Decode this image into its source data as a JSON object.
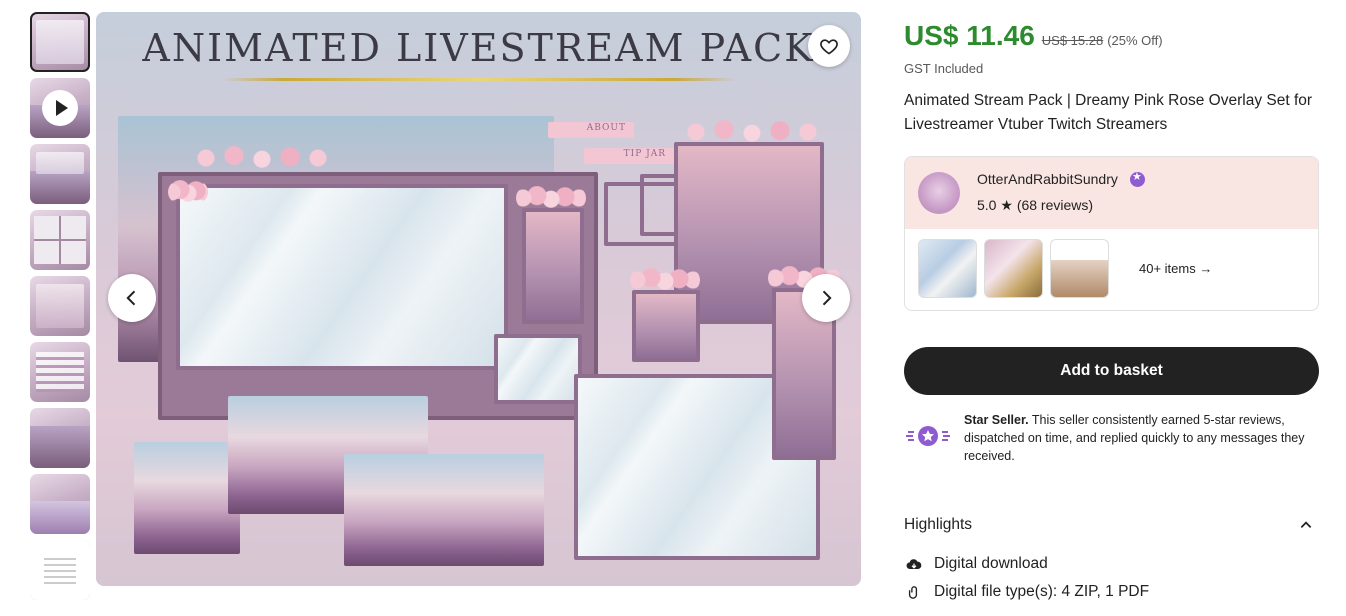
{
  "gallery": {
    "title_text": "ANIMATED LIVESTREAM PACK",
    "labels": {
      "about": "ABOUT",
      "tip_jar": "TIP JAR"
    },
    "thumbnails": [
      {
        "name": "thumb-overview"
      },
      {
        "name": "thumb-video"
      },
      {
        "name": "thumb-stream-screens"
      },
      {
        "name": "thumb-panels"
      },
      {
        "name": "thumb-alerts"
      },
      {
        "name": "thumb-bars"
      },
      {
        "name": "thumb-scenes"
      },
      {
        "name": "thumb-character"
      },
      {
        "name": "thumb-instructions"
      }
    ]
  },
  "listing": {
    "price": "US$ 11.46",
    "original_price": "US$ 15.28",
    "discount": "(25% Off)",
    "tax_note": "GST Included",
    "title": "Animated Stream Pack | Dreamy Pink Rose Overlay Set for Livestreamer Vtuber Twitch Streamers"
  },
  "shop": {
    "name": "OtterAndRabbitSundry",
    "rating": "5.0",
    "reviews": "(68 reviews)",
    "more_items": "40+ items"
  },
  "actions": {
    "add_to_basket": "Add to basket"
  },
  "star_seller": {
    "title": "Star Seller.",
    "text": "This seller consistently earned 5-star reviews, dispatched on time, and replied quickly to any messages they received."
  },
  "highlights": {
    "title": "Highlights",
    "items": [
      {
        "text": "Digital download",
        "icon": "download-cloud-icon"
      },
      {
        "text": "Digital file type(s): 4 ZIP, 1 PDF",
        "icon": "paperclip-icon"
      }
    ]
  },
  "colors": {
    "price": "#2e8a2e",
    "shop_header_bg": "#f9e6e3",
    "star_seller_purple": "#8e5bd1",
    "button_bg": "#222222"
  }
}
